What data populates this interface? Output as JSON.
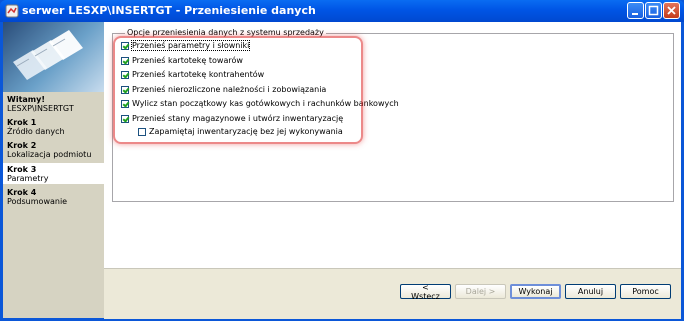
{
  "window": {
    "title": "serwer LESXP\\INSERTGT - Przeniesienie danych"
  },
  "sidebar": {
    "welcome_title": "Witamy!",
    "welcome_subtitle": "LESXP\\INSERTGT",
    "steps": [
      {
        "title": "Krok 1",
        "label": "Źródło danych"
      },
      {
        "title": "Krok 2",
        "label": "Lokalizacja podmiotu"
      },
      {
        "title": "Krok 3",
        "label": "Parametry"
      },
      {
        "title": "Krok 4",
        "label": "Podsumowanie"
      }
    ]
  },
  "options_group": {
    "label": "Opcje przeniesienia danych z systemu sprzedaży",
    "items": [
      {
        "label": "Przenieś parametry i słowniki",
        "checked": true
      },
      {
        "label": "Przenieś kartotekę towarów",
        "checked": true
      },
      {
        "label": "Przenieś kartotekę kontrahentów",
        "checked": true
      },
      {
        "label": "Przenieś nierozliczone należności i zobowiązania",
        "checked": true
      },
      {
        "label": "Wylicz stan początkowy kas gotówkowych i rachunków bankowych",
        "checked": true
      },
      {
        "label": "Przenieś stany magazynowe i utwórz inwentaryzację",
        "checked": true
      },
      {
        "label": "Zapamiętaj inwentaryzację bez jej wykonywania",
        "checked": false
      }
    ]
  },
  "buttons": {
    "back": "< Wstecz",
    "next": "Dalej >",
    "execute": "Wykonaj",
    "cancel": "Anuluj",
    "help": "Pomoc"
  }
}
